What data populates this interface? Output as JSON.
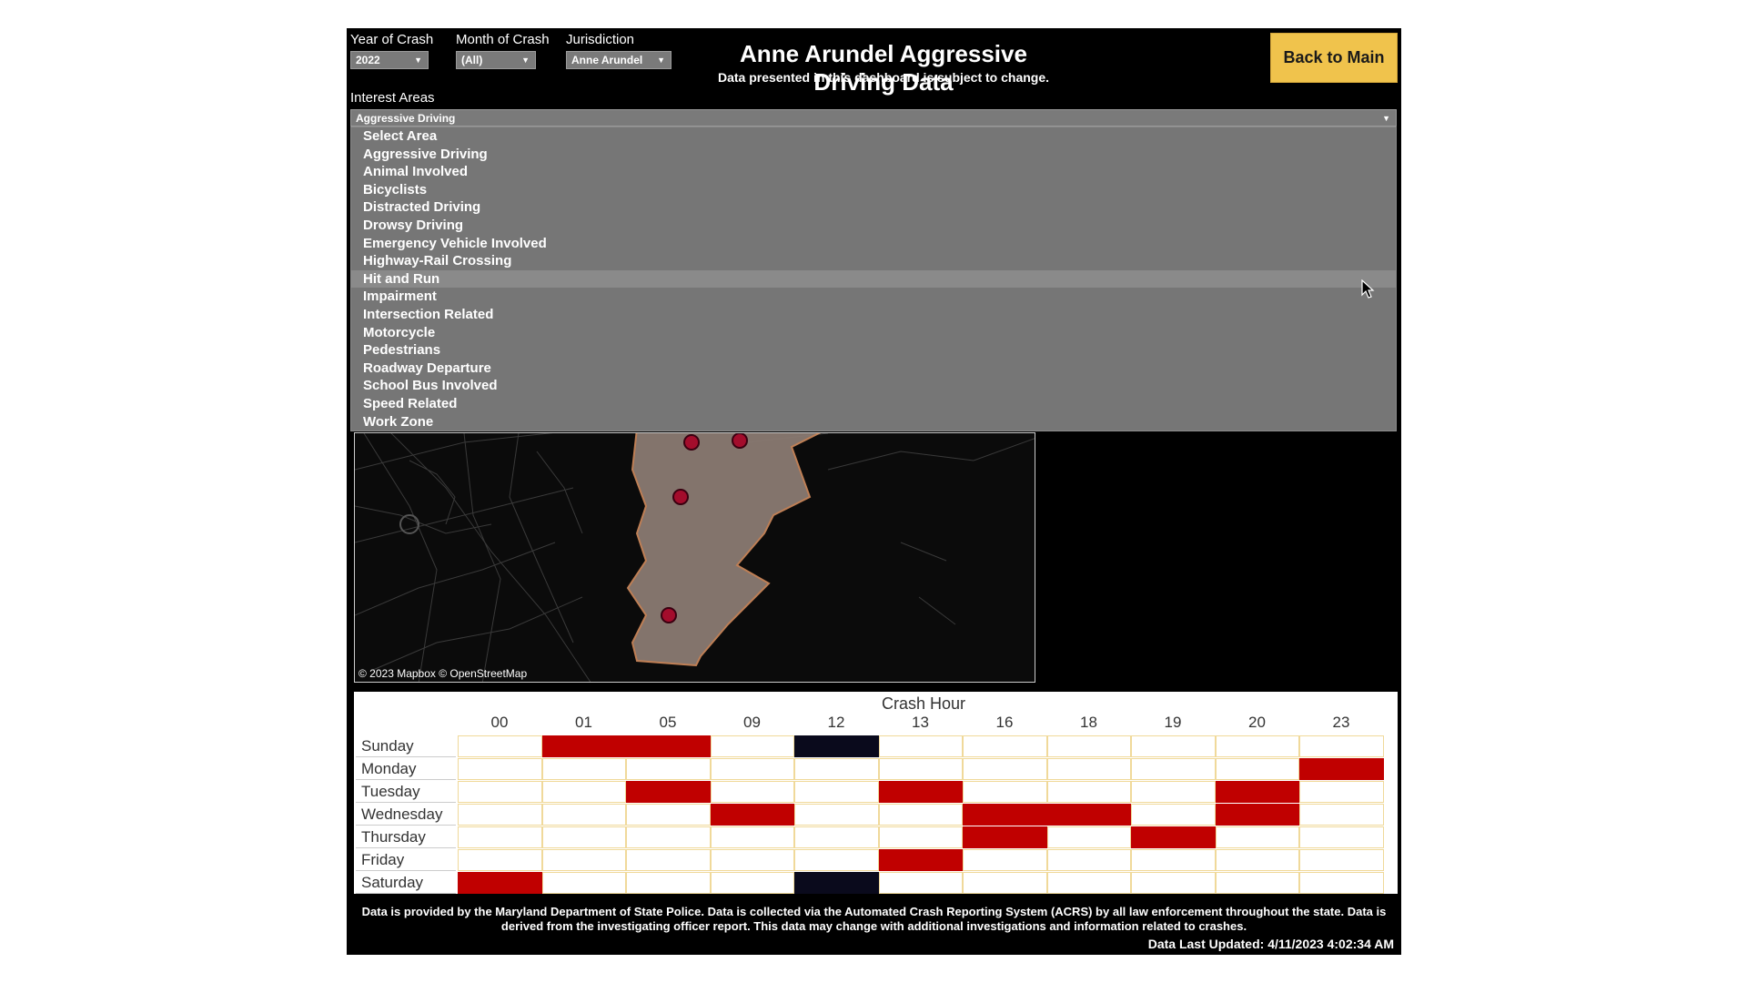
{
  "filters": {
    "year": {
      "label": "Year of Crash",
      "value": "2022"
    },
    "month": {
      "label": "Month of Crash",
      "value": "(All)"
    },
    "jurisdiction": {
      "label": "Jurisdiction",
      "value": "Anne Arundel"
    }
  },
  "header": {
    "title": "Anne Arundel Aggressive Driving Data",
    "subtitle": "Data presented in this dashboard is subject to change.",
    "back_button": "Back to Main"
  },
  "interest_areas": {
    "label": "Interest Areas",
    "selected": "Aggressive Driving",
    "highlighted": "Hit and Run",
    "options": [
      "Select Area",
      "Aggressive Driving",
      "Animal Involved",
      "Bicyclists",
      "Distracted Driving",
      "Drowsy Driving",
      "Emergency Vehicle Involved",
      "Highway-Rail Crossing",
      "Hit and Run",
      "Impairment",
      "Intersection Related",
      "Motorcycle",
      "Pedestrians",
      "Roadway Departure",
      "School Bus Involved",
      "Speed Related",
      "Work Zone"
    ]
  },
  "map": {
    "attribution": "© 2023 Mapbox © OpenStreetMap",
    "crash_points_count": 4
  },
  "chart_data": {
    "type": "heatmap",
    "title": "Crash Hour",
    "columns": [
      "00",
      "01",
      "05",
      "09",
      "12",
      "13",
      "16",
      "18",
      "19",
      "20",
      "23"
    ],
    "rows": [
      "Sunday",
      "Monday",
      "Tuesday",
      "Wednesday",
      "Thursday",
      "Friday",
      "Saturday"
    ],
    "cells": [
      [
        "",
        "red",
        "red",
        "",
        "black",
        "",
        "",
        "",
        "",
        "",
        ""
      ],
      [
        "",
        "",
        "",
        "",
        "",
        "",
        "",
        "",
        "",
        "",
        "red"
      ],
      [
        "",
        "",
        "red",
        "",
        "",
        "red",
        "",
        "",
        "",
        "red",
        ""
      ],
      [
        "",
        "",
        "",
        "red",
        "",
        "",
        "red",
        "red",
        "",
        "red",
        ""
      ],
      [
        "",
        "",
        "",
        "",
        "",
        "",
        "red",
        "",
        "red",
        "",
        ""
      ],
      [
        "",
        "",
        "",
        "",
        "",
        "red",
        "",
        "",
        "",
        "",
        ""
      ],
      [
        "red",
        "",
        "",
        "",
        "black",
        "",
        "",
        "",
        "",
        "",
        ""
      ]
    ],
    "colors": {
      "red": "#c00000",
      "black": "#0a0a1c",
      "empty": "#ffffff",
      "grid": "#f0d99a"
    }
  },
  "footer": {
    "line1": "Data is provided by the Maryland Department of State Police.  Data is collected via the Automated Crash Reporting System (ACRS) by all law enforcement throughout the state.  Data is",
    "line2": "derived from the investigating officer report.  This data may change with additional investigations and information related to crashes.",
    "updated": "Data Last Updated: 4/11/2023 4:02:34 AM"
  }
}
